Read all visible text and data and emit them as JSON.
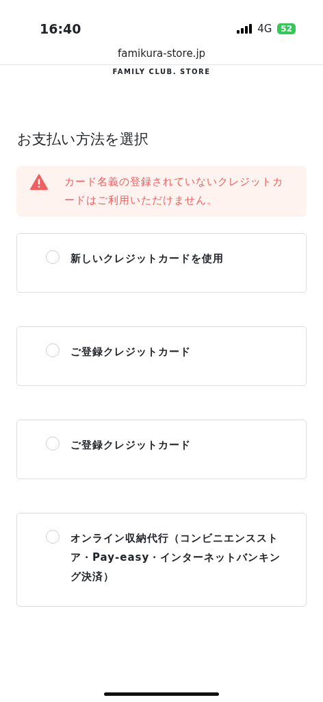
{
  "status_bar": {
    "time": "16:40",
    "network": "4G",
    "battery": "52"
  },
  "browser": {
    "url": "famikura-store.jp"
  },
  "site": {
    "name": "FAMILY CLUB. STORE"
  },
  "page": {
    "title": "お支払い方法を選択"
  },
  "alert": {
    "message": "カード名義の登録されていないクレジットカードはご利用いただけません。"
  },
  "payment_options": [
    {
      "label": "新しいクレジットカードを使用",
      "selected": false
    },
    {
      "label": "ご登録クレジットカード",
      "selected": false
    },
    {
      "label": "ご登録クレジットカード",
      "selected": false
    },
    {
      "label": "オンライン収納代行（コンビニエンスストア・Pay-easy・インターネットバンキング決済）",
      "selected": false
    }
  ]
}
